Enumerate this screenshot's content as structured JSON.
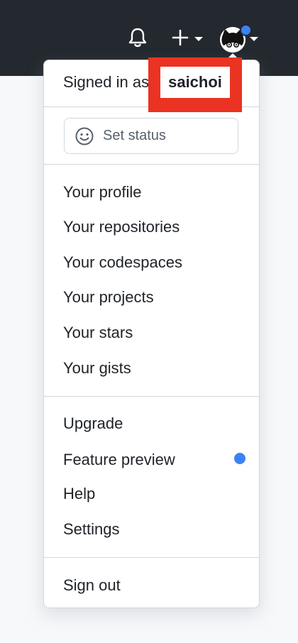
{
  "header": {
    "notifications_icon": "bell-icon",
    "create_icon": "plus-icon",
    "avatar_icon": "cat-avatar-icon"
  },
  "dropdown": {
    "signed_in_prefix": "Signed in as",
    "username": "saichoi",
    "set_status_label": "Set status",
    "profile_items": [
      "Your profile",
      "Your repositories",
      "Your codespaces",
      "Your projects",
      "Your stars",
      "Your gists"
    ],
    "settings_items": [
      "Upgrade",
      "Feature preview",
      "Help",
      "Settings"
    ],
    "sign_out_label": "Sign out"
  },
  "colors": {
    "header_bg": "#24292f",
    "highlight": "#ea3323",
    "notification_dot": "#3b82f6"
  }
}
